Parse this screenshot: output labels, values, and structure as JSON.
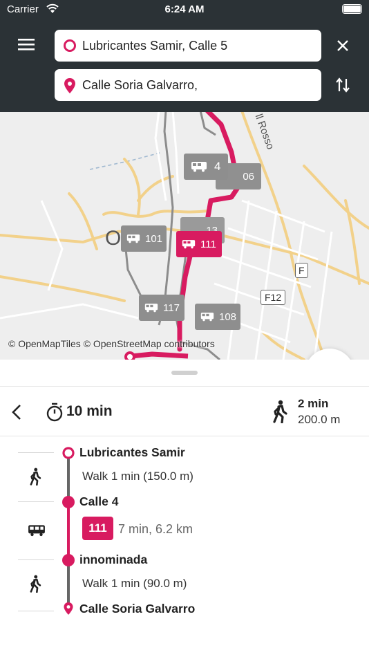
{
  "status_bar": {
    "carrier": "Carrier",
    "time": "6:24 AM"
  },
  "search": {
    "origin": "Lubricantes Samir, Calle 5",
    "destination": "Calle Soria Galvarro,"
  },
  "map": {
    "attribution": "© OpenMapTiles © OpenStreetMap contributors",
    "bus_labels": [
      {
        "id": "4",
        "label": "4"
      },
      {
        "id": "06",
        "label": "06"
      },
      {
        "id": "13",
        "label": "13"
      },
      {
        "id": "101",
        "label": "101"
      },
      {
        "id": "111",
        "label": "111"
      },
      {
        "id": "117",
        "label": "117"
      },
      {
        "id": "108",
        "label": "108"
      }
    ],
    "road_labels": [
      "F12",
      "F",
      "ll Rosso"
    ],
    "city_fragment": "O"
  },
  "itinerary": {
    "duration": "10 min",
    "walk_time": "2 min",
    "walk_distance": "200.0 m",
    "steps": {
      "origin_stop": "Lubricantes Samir",
      "walk1": "Walk 1 min (150.0 m)",
      "board_stop": "Calle 4",
      "route": "111",
      "ride": "7 min, 6.2 km",
      "alight_stop": "innominada",
      "walk2": "Walk 1 min (90.0 m)",
      "destination_stop": "Calle Soria Galvarro"
    }
  },
  "colors": {
    "accent": "#d81b60",
    "header": "#2b3236",
    "bus_gray": "#8a8a8a",
    "walk_gray": "#666666"
  },
  "icons": [
    "menu-icon",
    "origin-circle-icon",
    "destination-pin-icon",
    "close-icon",
    "swap-icon",
    "share-icon",
    "locate-icon",
    "back-icon",
    "timer-icon",
    "walk-icon",
    "bus-icon"
  ]
}
